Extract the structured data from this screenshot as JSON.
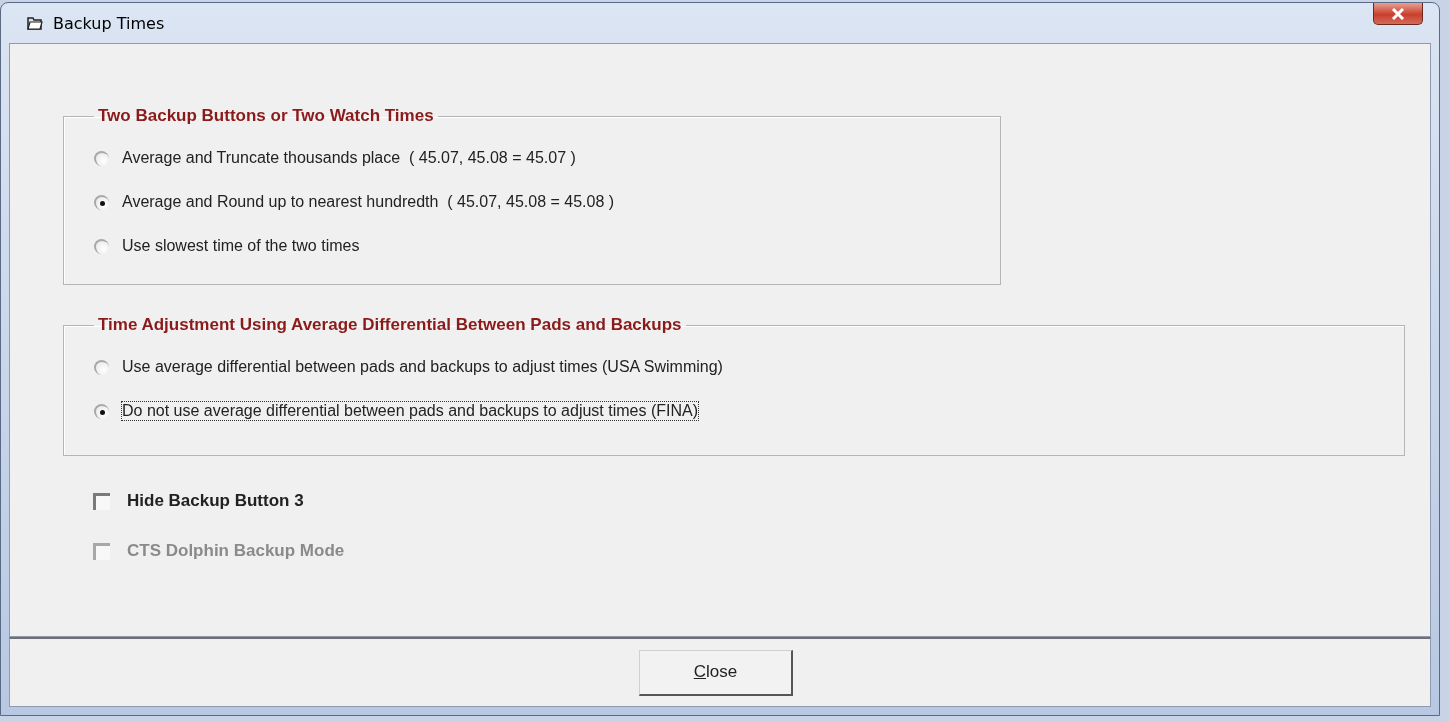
{
  "window": {
    "title": "Backup Times"
  },
  "groups": [
    {
      "title": "Two Backup Buttons or Two Watch Times",
      "options": [
        {
          "label": "Average and Truncate thousands place  ( 45.07, 45.08 = 45.07 )",
          "selected": false,
          "focused": false
        },
        {
          "label": "Average and Round up to nearest hundredth  ( 45.07, 45.08 = 45.08 )",
          "selected": true,
          "focused": false
        },
        {
          "label": "Use slowest time of the two times",
          "selected": false,
          "focused": false
        }
      ]
    },
    {
      "title": "Time Adjustment Using Average Differential Between Pads and Backups",
      "options": [
        {
          "label": "Use average differential between pads and backups to adjust times (USA Swimming)",
          "selected": false,
          "focused": false
        },
        {
          "label": "Do not use average differential between pads and backups to adjust times (FINA)",
          "selected": true,
          "focused": true
        }
      ]
    }
  ],
  "checkboxes": [
    {
      "label": "Hide Backup Button 3",
      "checked": false,
      "disabled": false
    },
    {
      "label": "CTS Dolphin Backup Mode",
      "checked": false,
      "disabled": true
    }
  ],
  "close_button": {
    "access_key": "C",
    "label_rest": "lose"
  }
}
